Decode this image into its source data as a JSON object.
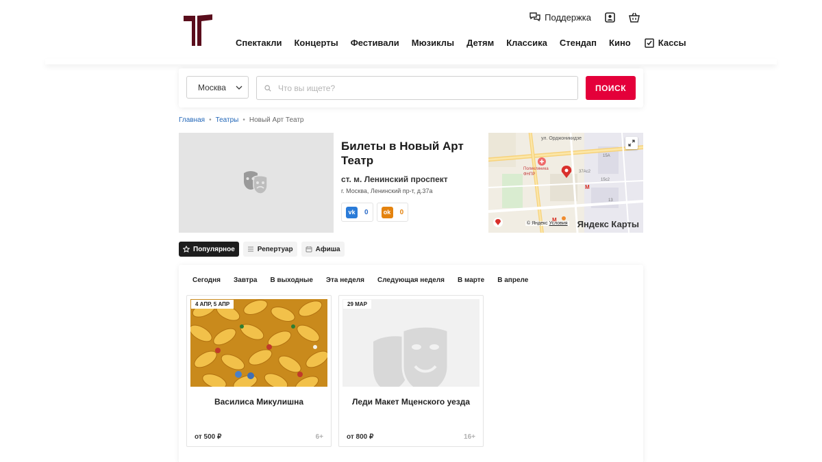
{
  "header": {
    "logo_name": "theatre-logo",
    "support_label": "Поддержка",
    "nav": [
      {
        "label": "Спектакли"
      },
      {
        "label": "Концерты"
      },
      {
        "label": "Фестивали"
      },
      {
        "label": "Мюзиклы"
      },
      {
        "label": "Детям"
      },
      {
        "label": "Классика"
      },
      {
        "label": "Стендап"
      },
      {
        "label": "Кино"
      }
    ],
    "kassy_label": "Кассы"
  },
  "search": {
    "city": "Москва",
    "placeholder": "Что вы ищете?",
    "button_label": "ПОИСК",
    "accent_color": "#e4003a"
  },
  "breadcrumb": {
    "items": [
      "Главная",
      "Театры"
    ],
    "current": "Новый Арт Театр"
  },
  "venue": {
    "title": "Билеты в Новый Арт Театр",
    "metro": "ст. м. Ленинский проспект",
    "address": "г. Москва, Ленинский пр-т, д.37а",
    "vk_count": "0",
    "ok_count": "0"
  },
  "map": {
    "street_label": "ул. Орджоникидзе",
    "poi_label": "Поликлиника ФНПР",
    "copyright": "© Яндекс",
    "terms": "Условия",
    "brand": "Яндекс Карты"
  },
  "tabs": [
    {
      "label": "Популярное",
      "icon": "star-icon",
      "active": true
    },
    {
      "label": "Репертуар",
      "icon": "list-icon",
      "active": false
    },
    {
      "label": "Афиша",
      "icon": "calendar-icon",
      "active": false
    }
  ],
  "filters": [
    "Сегодня",
    "Завтра",
    "В выходные",
    "Эта неделя",
    "Следующая неделя",
    "В марте",
    "В апреле"
  ],
  "events": [
    {
      "date": "4 АПР, 5 АПР",
      "title": "Василиса Микулишна",
      "price": "от 500 ₽",
      "age": "6+",
      "image": "golden-braids"
    },
    {
      "date": "29 МАР",
      "title": "Леди Макет Мценского уезда",
      "price": "от 800 ₽",
      "age": "16+",
      "image": "theatre-masks-placeholder"
    }
  ]
}
